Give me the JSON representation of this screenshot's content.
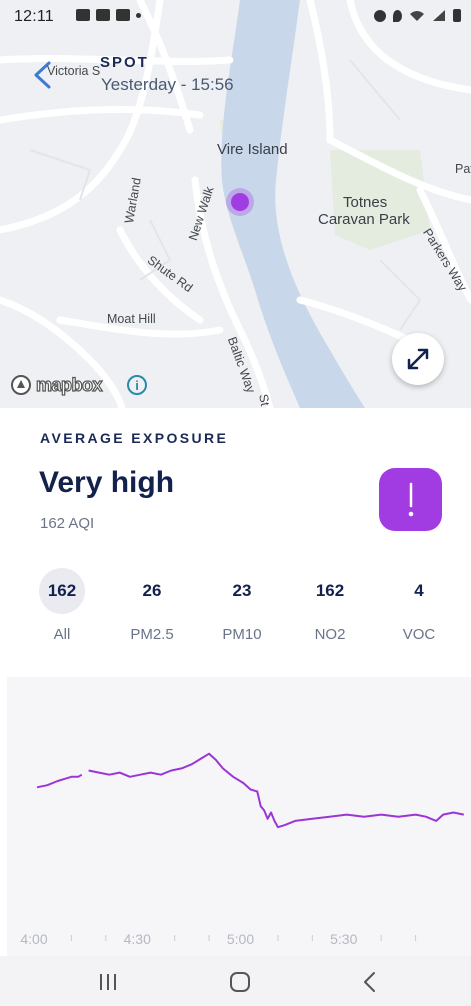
{
  "status_bar": {
    "time": "12:11"
  },
  "header": {
    "title": "SPOT",
    "subtitle": "Yesterday - 15:56"
  },
  "map": {
    "labels": {
      "vire_island": "Vire Island",
      "totnes_line1": "Totnes",
      "totnes_line2": "Caravan Park",
      "warland": "Warland",
      "new_walk": "New Walk",
      "shute_rd": "Shute Rd",
      "moat_hill": "Moat Hill",
      "baltic_way": "Baltic Way",
      "parkers_way": "Parkers Way",
      "victoria": "Victoria S",
      "pat": "Pat",
      "st": "St"
    },
    "attribution": "mapbox",
    "marker_color": "#a13ce3"
  },
  "exposure": {
    "section_label": "AVERAGE EXPOSURE",
    "level": "Very high",
    "aqi_text": "162 AQI",
    "badge_color": "#a13ce3",
    "badge_icon": "exclamation-icon"
  },
  "pollutants": [
    {
      "value": "162",
      "label": "All",
      "active": true
    },
    {
      "value": "26",
      "label": "PM2.5",
      "active": false
    },
    {
      "value": "23",
      "label": "PM10",
      "active": false
    },
    {
      "value": "162",
      "label": "NO2",
      "active": false
    },
    {
      "value": "4",
      "label": "VOC",
      "active": false
    }
  ],
  "chart_data": {
    "type": "line",
    "title": "",
    "xlabel": "",
    "ylabel": "",
    "tick_labels": [
      "4:00",
      "4:30",
      "5:00",
      "5:30"
    ],
    "xlim": [
      0,
      120
    ],
    "ylim": [
      0,
      100
    ],
    "grid": false,
    "series": [
      {
        "color": "#9b35d6",
        "segments": [
          [
            [
              0,
              57
            ],
            [
              3,
              58
            ],
            [
              6,
              60
            ],
            [
              8,
              61
            ],
            [
              10,
              62
            ],
            [
              12,
              62
            ],
            [
              13,
              63
            ]
          ],
          [
            [
              15,
              65
            ],
            [
              18,
              64
            ],
            [
              21,
              63
            ],
            [
              24,
              64
            ],
            [
              27,
              62
            ],
            [
              30,
              63
            ],
            [
              33,
              64
            ],
            [
              36,
              63
            ],
            [
              39,
              65
            ],
            [
              42,
              66
            ],
            [
              45,
              68
            ],
            [
              48,
              71
            ],
            [
              50,
              73
            ],
            [
              52,
              70
            ],
            [
              54,
              66
            ],
            [
              57,
              62
            ],
            [
              60,
              59
            ],
            [
              62,
              56
            ],
            [
              64,
              55
            ],
            [
              65,
              48
            ],
            [
              66,
              46
            ],
            [
              67,
              42
            ],
            [
              68,
              45
            ],
            [
              69,
              41
            ],
            [
              70,
              38
            ],
            [
              72,
              39
            ],
            [
              75,
              41
            ],
            [
              80,
              42
            ],
            [
              85,
              43
            ],
            [
              90,
              44
            ],
            [
              95,
              43
            ],
            [
              100,
              44
            ],
            [
              105,
              43
            ],
            [
              110,
              44
            ],
            [
              113,
              43
            ],
            [
              116,
              41
            ],
            [
              118,
              44
            ],
            [
              121,
              45
            ],
            [
              124,
              44
            ]
          ]
        ]
      }
    ]
  },
  "nav": {
    "recents_icon": "recents-icon",
    "home_icon": "home-icon",
    "back_icon": "back-icon"
  }
}
